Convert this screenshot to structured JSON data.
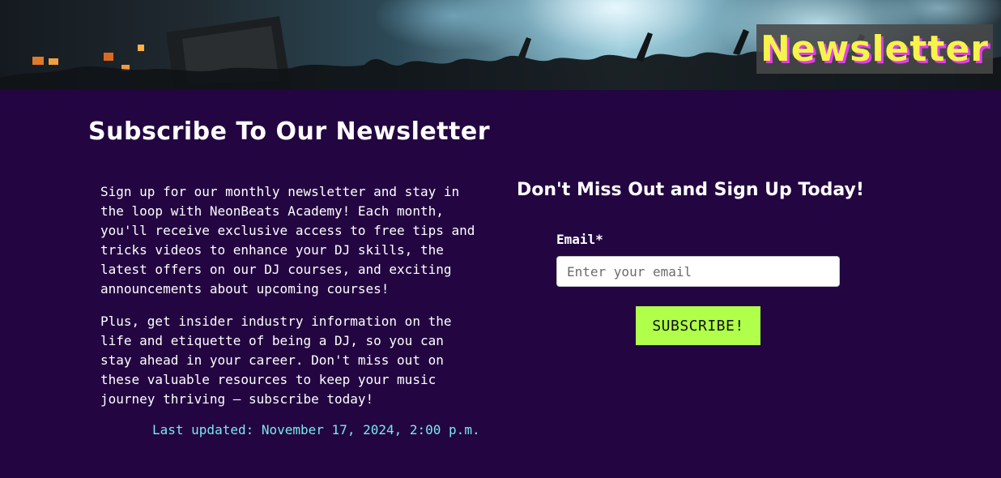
{
  "hero": {
    "title": "Newsletter",
    "colors": {
      "title": "#f6f34a",
      "title_shadow": "#e23cf0",
      "badge_bg": "#484848"
    }
  },
  "main": {
    "title": "Subscribe To Our Newsletter",
    "intro": [
      "Sign up for our monthly newsletter and stay in the loop with NeonBeats Academy! Each month, you'll receive exclusive access to free tips and tricks videos to enhance your DJ skills, the latest offers on our DJ courses, and exciting announcements about upcoming courses!",
      "Plus, get insider industry information on the life and etiquette of being a DJ, so you can stay ahead in your career. Don't miss out on these valuable resources to keep your music journey thriving — subscribe today!"
    ],
    "last_updated": "Last updated: November 17, 2024, 2:00 p.m."
  },
  "form": {
    "heading": "Don't Miss Out and Sign Up Today!",
    "email_label": "Email*",
    "email_placeholder": "Enter your email",
    "email_value": "",
    "submit_label": "SUBSCRIBE!"
  },
  "colors": {
    "background": "#230641",
    "accent_button": "#b0ff4a",
    "timestamp": "#7be6ec"
  }
}
